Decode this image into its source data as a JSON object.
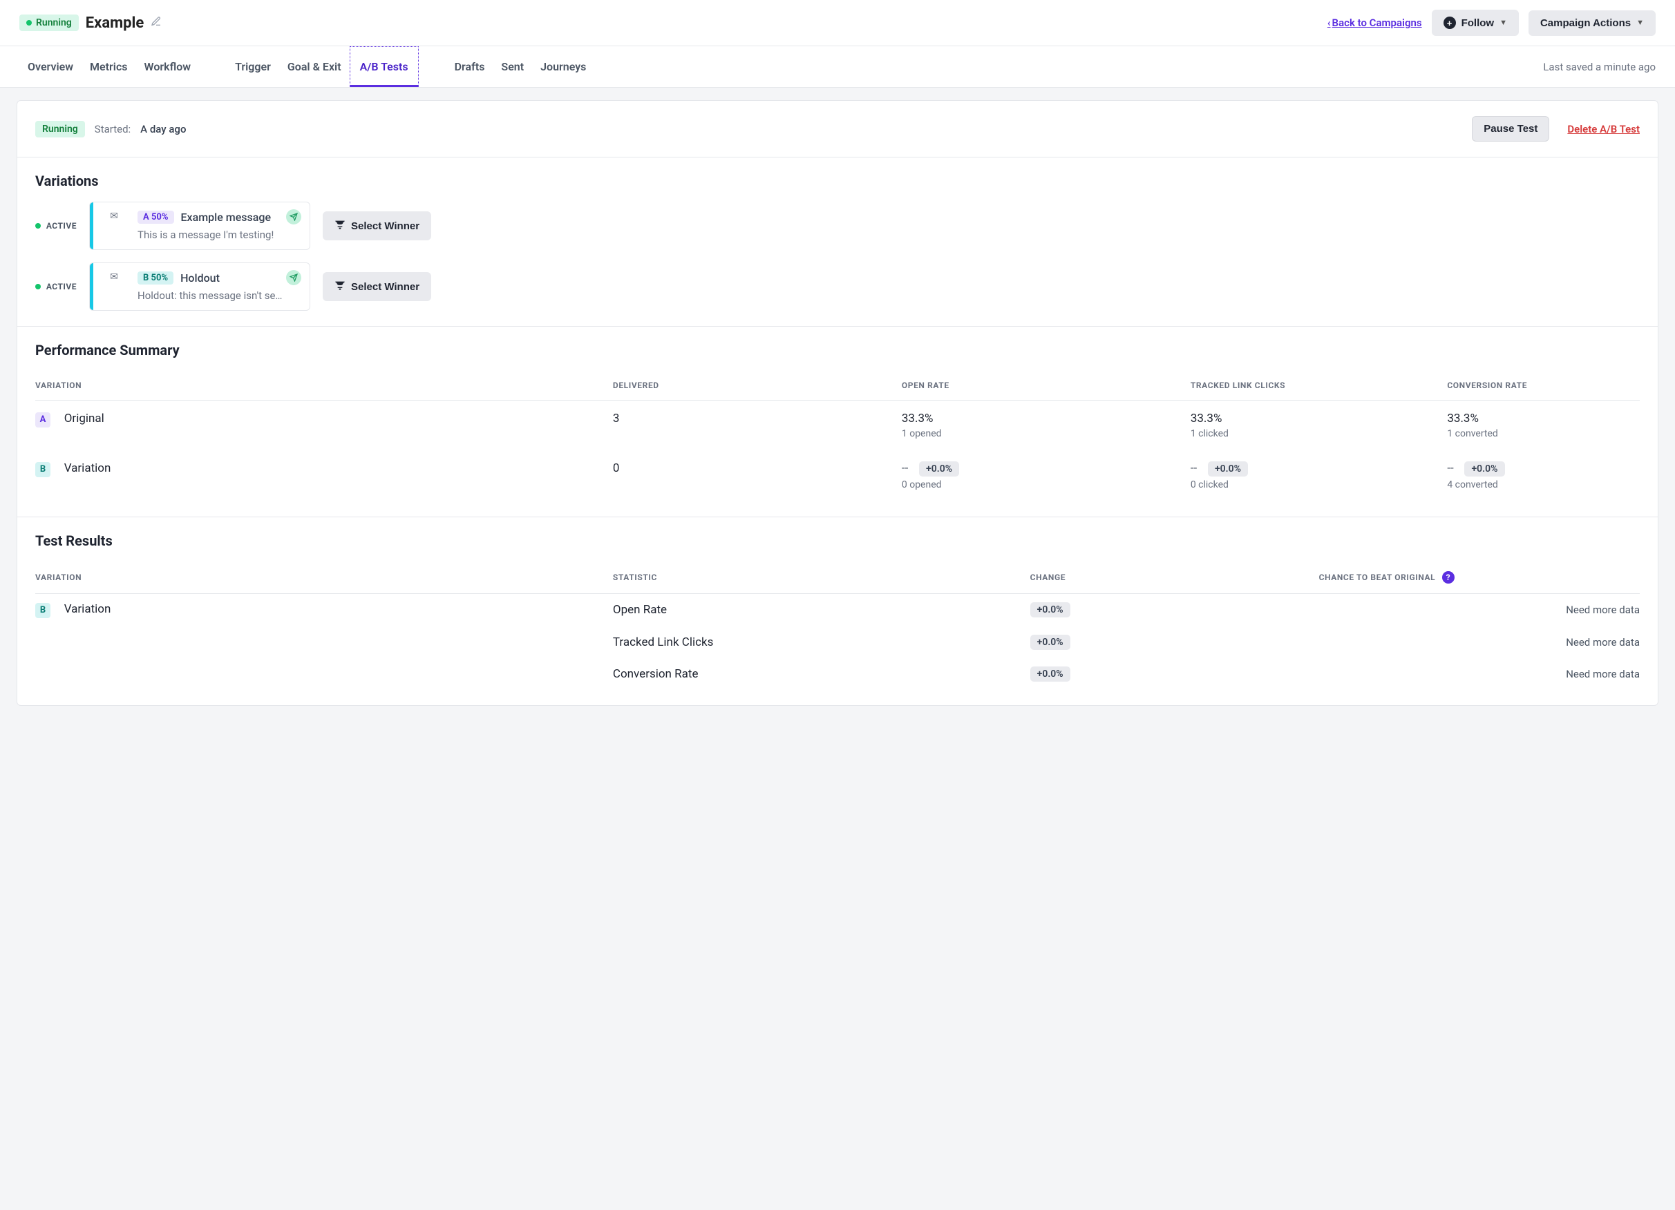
{
  "header": {
    "status": "Running",
    "title": "Example",
    "back_link": "Back to Campaigns",
    "follow_label": "Follow",
    "actions_label": "Campaign Actions"
  },
  "tabs": {
    "items": [
      "Overview",
      "Metrics",
      "Workflow",
      "Trigger",
      "Goal & Exit",
      "A/B Tests",
      "Drafts",
      "Sent",
      "Journeys"
    ],
    "active_index": 5,
    "last_saved": "Last saved a minute ago"
  },
  "status_bar": {
    "status": "Running",
    "started_label": "Started:",
    "started_value": "A day ago",
    "pause_label": "Pause Test",
    "delete_label": "Delete A/B Test"
  },
  "variations": {
    "title": "Variations",
    "active_label": "ACTIVE",
    "select_winner_label": "Select Winner",
    "items": [
      {
        "letter": "A",
        "pct": "A 50%",
        "name": "Example message",
        "desc": "This is a message I'm testing!"
      },
      {
        "letter": "B",
        "pct": "B 50%",
        "name": "Holdout",
        "desc": "Holdout: this message isn't se…"
      }
    ]
  },
  "performance": {
    "title": "Performance Summary",
    "headers": [
      "VARIATION",
      "DELIVERED",
      "OPEN RATE",
      "TRACKED LINK CLICKS",
      "CONVERSION RATE"
    ],
    "rows": [
      {
        "badge": "A",
        "name": "Original",
        "delivered": "3",
        "open_rate": "33.3%",
        "open_sub": "1 opened",
        "clicks": "33.3%",
        "clicks_sub": "1 clicked",
        "conv": "33.3%",
        "conv_sub": "1 converted"
      },
      {
        "badge": "B",
        "name": "Variation",
        "delivered": "0",
        "open_rate": "--",
        "open_delta": "+0.0%",
        "open_sub": "0 opened",
        "clicks": "--",
        "clicks_delta": "+0.0%",
        "clicks_sub": "0 clicked",
        "conv": "--",
        "conv_delta": "+0.0%",
        "conv_sub": "4 converted"
      }
    ]
  },
  "results": {
    "title": "Test Results",
    "headers": [
      "VARIATION",
      "STATISTIC",
      "CHANGE",
      "CHANCE TO BEAT ORIGINAL"
    ],
    "variation_badge": "B",
    "variation_name": "Variation",
    "rows": [
      {
        "stat": "Open Rate",
        "change": "+0.0%",
        "chance": "Need more data"
      },
      {
        "stat": "Tracked Link Clicks",
        "change": "+0.0%",
        "chance": "Need more data"
      },
      {
        "stat": "Conversion Rate",
        "change": "+0.0%",
        "chance": "Need more data"
      }
    ]
  }
}
